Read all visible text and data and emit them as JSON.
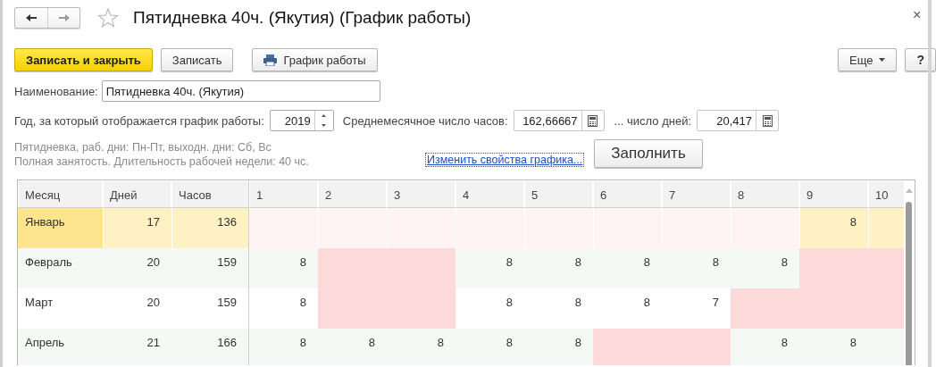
{
  "window": {
    "title": "Пятидневка 40ч. (Якутия) (График работы)",
    "close": "×"
  },
  "toolbar": {
    "buttons": [
      {
        "label": "Записать и закрыть",
        "kind": "primary"
      },
      {
        "label": "Записать",
        "kind": "plain"
      },
      {
        "label": "График работы",
        "kind": "print"
      }
    ],
    "more": "Еще",
    "help": "?"
  },
  "form": {
    "name_label": "Наименование:",
    "name_value": "Пятидневка 40ч. (Якутия)",
    "year_label": "Год, за который отображается график работы:",
    "year_value": "2019",
    "avg_hours_label": "Среднемесячное число часов:",
    "avg_hours_value": "162,66667",
    "avg_days_label": "... число дней:",
    "avg_days_value": "20,417",
    "description": [
      "Пятидневка, раб. дни: Пн-Пт, выходн. дни: Сб, Вс",
      "Полная занятость. Длительность рабочей недели: 40 чс."
    ],
    "link": "Изменить свойства графика...",
    "fill_button": "Заполнить"
  },
  "table": {
    "columns": [
      "Месяц",
      "Дней",
      "Часов",
      "1",
      "2",
      "3",
      "4",
      "5",
      "6",
      "7",
      "8",
      "9",
      "10"
    ],
    "rows": [
      {
        "month": "Январь",
        "days": "17",
        "hours": "136",
        "selected": true,
        "cells": [
          {
            "kind": "off"
          },
          {
            "kind": "off"
          },
          {
            "kind": "off"
          },
          {
            "kind": "off"
          },
          {
            "kind": "off"
          },
          {
            "kind": "off"
          },
          {
            "kind": "off"
          },
          {
            "kind": "off"
          },
          {
            "kind": "work",
            "value": "8"
          },
          {
            "kind": "work"
          }
        ]
      },
      {
        "month": "Февраль",
        "days": "20",
        "hours": "159",
        "selected": false,
        "cells": [
          {
            "kind": "work",
            "value": "8"
          },
          {
            "kind": "off"
          },
          {
            "kind": "off"
          },
          {
            "kind": "work",
            "value": "8"
          },
          {
            "kind": "work",
            "value": "8"
          },
          {
            "kind": "work",
            "value": "8"
          },
          {
            "kind": "work",
            "value": "8"
          },
          {
            "kind": "work",
            "value": "8"
          },
          {
            "kind": "off"
          },
          {
            "kind": "off"
          }
        ]
      },
      {
        "month": "Март",
        "days": "20",
        "hours": "159",
        "selected": false,
        "cells": [
          {
            "kind": "work",
            "value": "8"
          },
          {
            "kind": "off"
          },
          {
            "kind": "off"
          },
          {
            "kind": "work",
            "value": "8"
          },
          {
            "kind": "work",
            "value": "8"
          },
          {
            "kind": "work",
            "value": "8"
          },
          {
            "kind": "work",
            "value": "7"
          },
          {
            "kind": "off"
          },
          {
            "kind": "off"
          },
          {
            "kind": "off"
          }
        ]
      },
      {
        "month": "Апрель",
        "days": "21",
        "hours": "166",
        "selected": false,
        "cells": [
          {
            "kind": "work",
            "value": "8"
          },
          {
            "kind": "work",
            "value": "8"
          },
          {
            "kind": "work",
            "value": "8"
          },
          {
            "kind": "work",
            "value": "8"
          },
          {
            "kind": "work",
            "value": "8"
          },
          {
            "kind": "off"
          },
          {
            "kind": "off"
          },
          {
            "kind": "work",
            "value": "8"
          },
          {
            "kind": "work",
            "value": "8"
          },
          {
            "kind": "work"
          }
        ]
      }
    ]
  }
}
